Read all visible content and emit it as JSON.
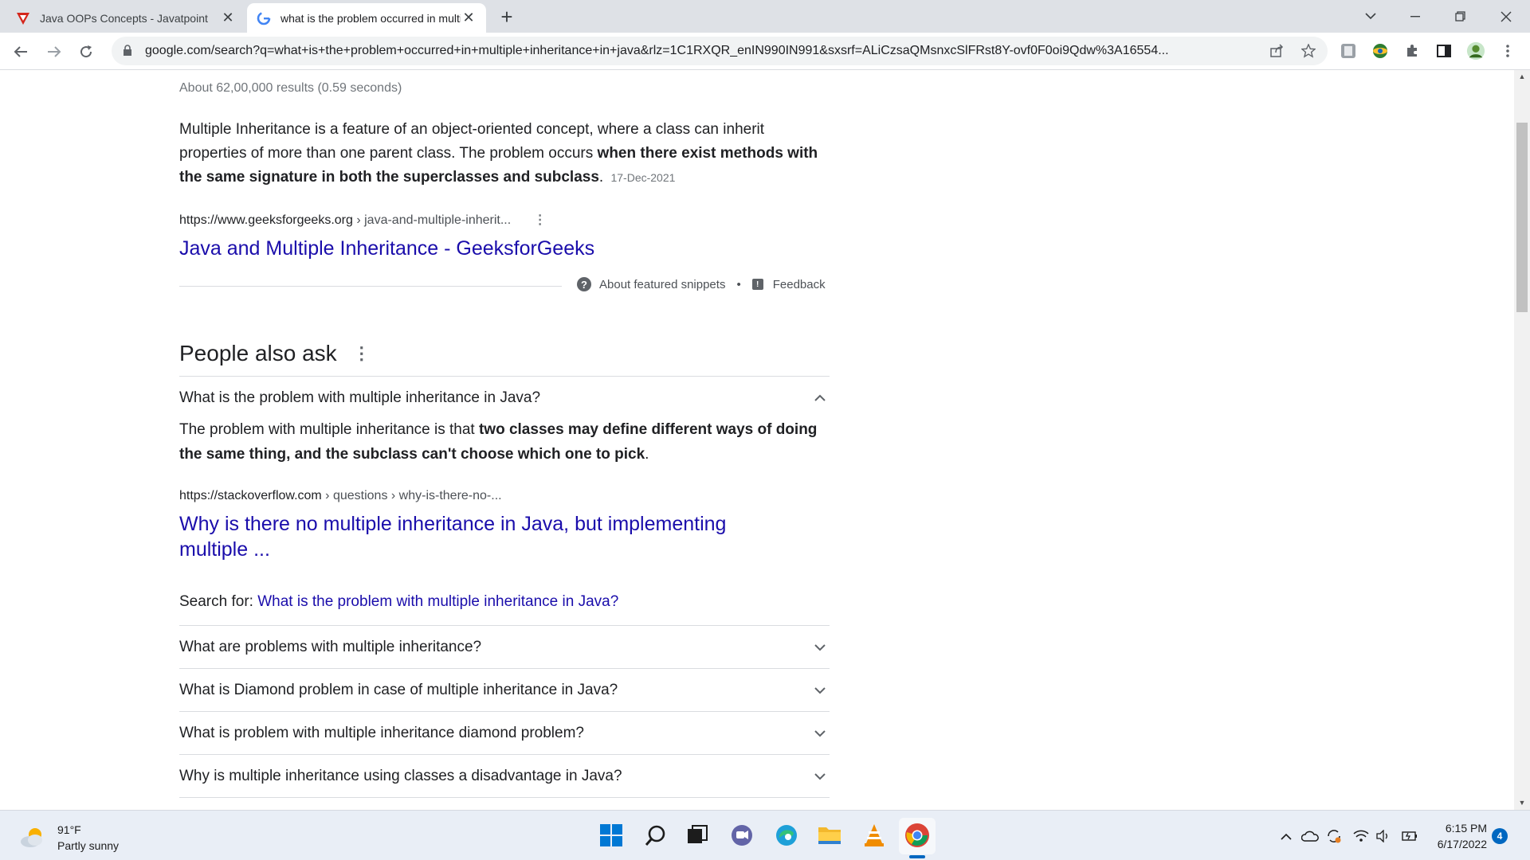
{
  "browser": {
    "tabs": [
      {
        "title": "Java OOPs Concepts - Javatpoint",
        "favicon": "javatpoint-icon",
        "active": false
      },
      {
        "title": "what is the problem occurred in multiple",
        "favicon": "google-icon",
        "active": true
      }
    ],
    "url": "google.com/search?q=what+is+the+problem+occurred+in+multiple+inheritance+in+java&rlz=1C1RXQR_enIN990IN991&sxsrf=ALiCzsaQMsnxcSlFRst8Y-ovf0F0oi9Qdw%3A16554..."
  },
  "results": {
    "stats": "About 62,00,000 results (0.59 seconds)",
    "featured": {
      "text_before": "Multiple Inheritance is a feature of an object-oriented concept, where a class can inherit properties of more than one parent class. The problem occurs ",
      "text_bold": "when there exist methods with the same signature in both the superclasses and subclass",
      "text_after": ".",
      "date": "17-Dec-2021",
      "cite_domain": "https://www.geeksforgeeks.org",
      "cite_path": " › java-and-multiple-inherit...",
      "link_title": "Java and Multiple Inheritance - GeeksforGeeks",
      "about_label": "About featured snippets",
      "separator": "•",
      "feedback_label": "Feedback"
    },
    "paa": {
      "heading": "People also ask",
      "expanded": {
        "question": "What is the problem with multiple inheritance in Java?",
        "answer_before": "The problem with multiple inheritance is that ",
        "answer_bold": "two classes may define different ways of doing the same thing, and the subclass can't choose which one to pick",
        "answer_after": ".",
        "cite_domain": "https://stackoverflow.com",
        "cite_path": " › questions › why-is-there-no-...",
        "link_line1": "Why is there no multiple inheritance in Java, but implementing",
        "link_line2": "multiple ...",
        "search_for_label": "Search for: ",
        "search_for_link": "What is the problem with multiple inheritance in Java?"
      },
      "questions": [
        "What are problems with multiple inheritance?",
        "What is Diamond problem in case of multiple inheritance in Java?",
        "What is problem with multiple inheritance diamond problem?",
        "Why is multiple inheritance using classes a disadvantage in Java?"
      ]
    }
  },
  "taskbar": {
    "weather_temp": "91°F",
    "weather_desc": "Partly sunny",
    "time": "6:15 PM",
    "date": "6/17/2022",
    "notifications": "4"
  },
  "colors": {
    "link": "#1a0dab",
    "accent": "#0067c0"
  }
}
